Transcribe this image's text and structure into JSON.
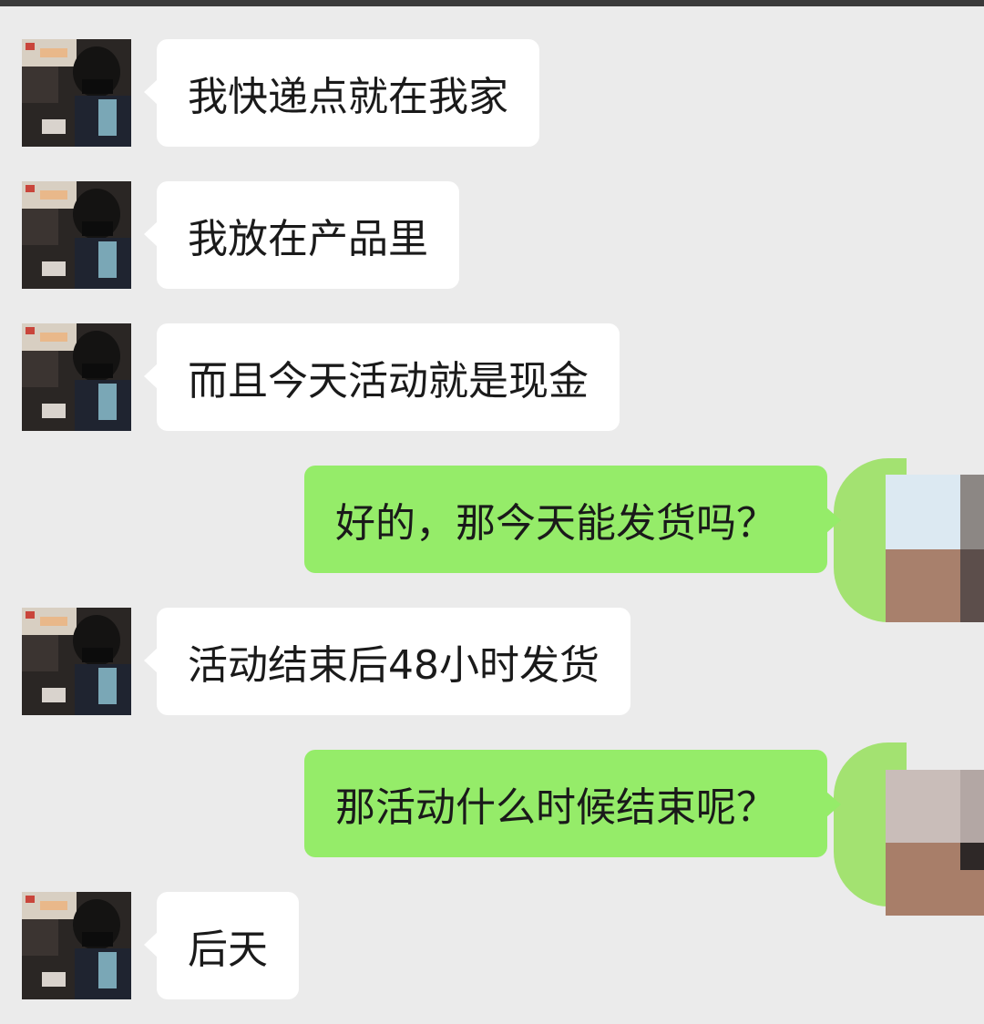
{
  "messages": [
    {
      "side": "in",
      "text": "我快递点就在我家"
    },
    {
      "side": "in",
      "text": "我放在产品里"
    },
    {
      "side": "in",
      "text": "而且今天活动就是现金"
    },
    {
      "side": "out",
      "text": "好的，那今天能发货吗？"
    },
    {
      "side": "in",
      "text": "活动结束后48小时发货"
    },
    {
      "side": "out",
      "text": "那活动什么时候结束呢？"
    },
    {
      "side": "in",
      "text": "后天"
    }
  ],
  "colors": {
    "background": "#ebebeb",
    "incoming_bubble": "#ffffff",
    "outgoing_bubble": "#95ec69",
    "text": "#1a1a1a"
  },
  "icons": {
    "incoming_avatar": "person-photo-avatar",
    "outgoing_avatar": "pixelated-avatar"
  }
}
